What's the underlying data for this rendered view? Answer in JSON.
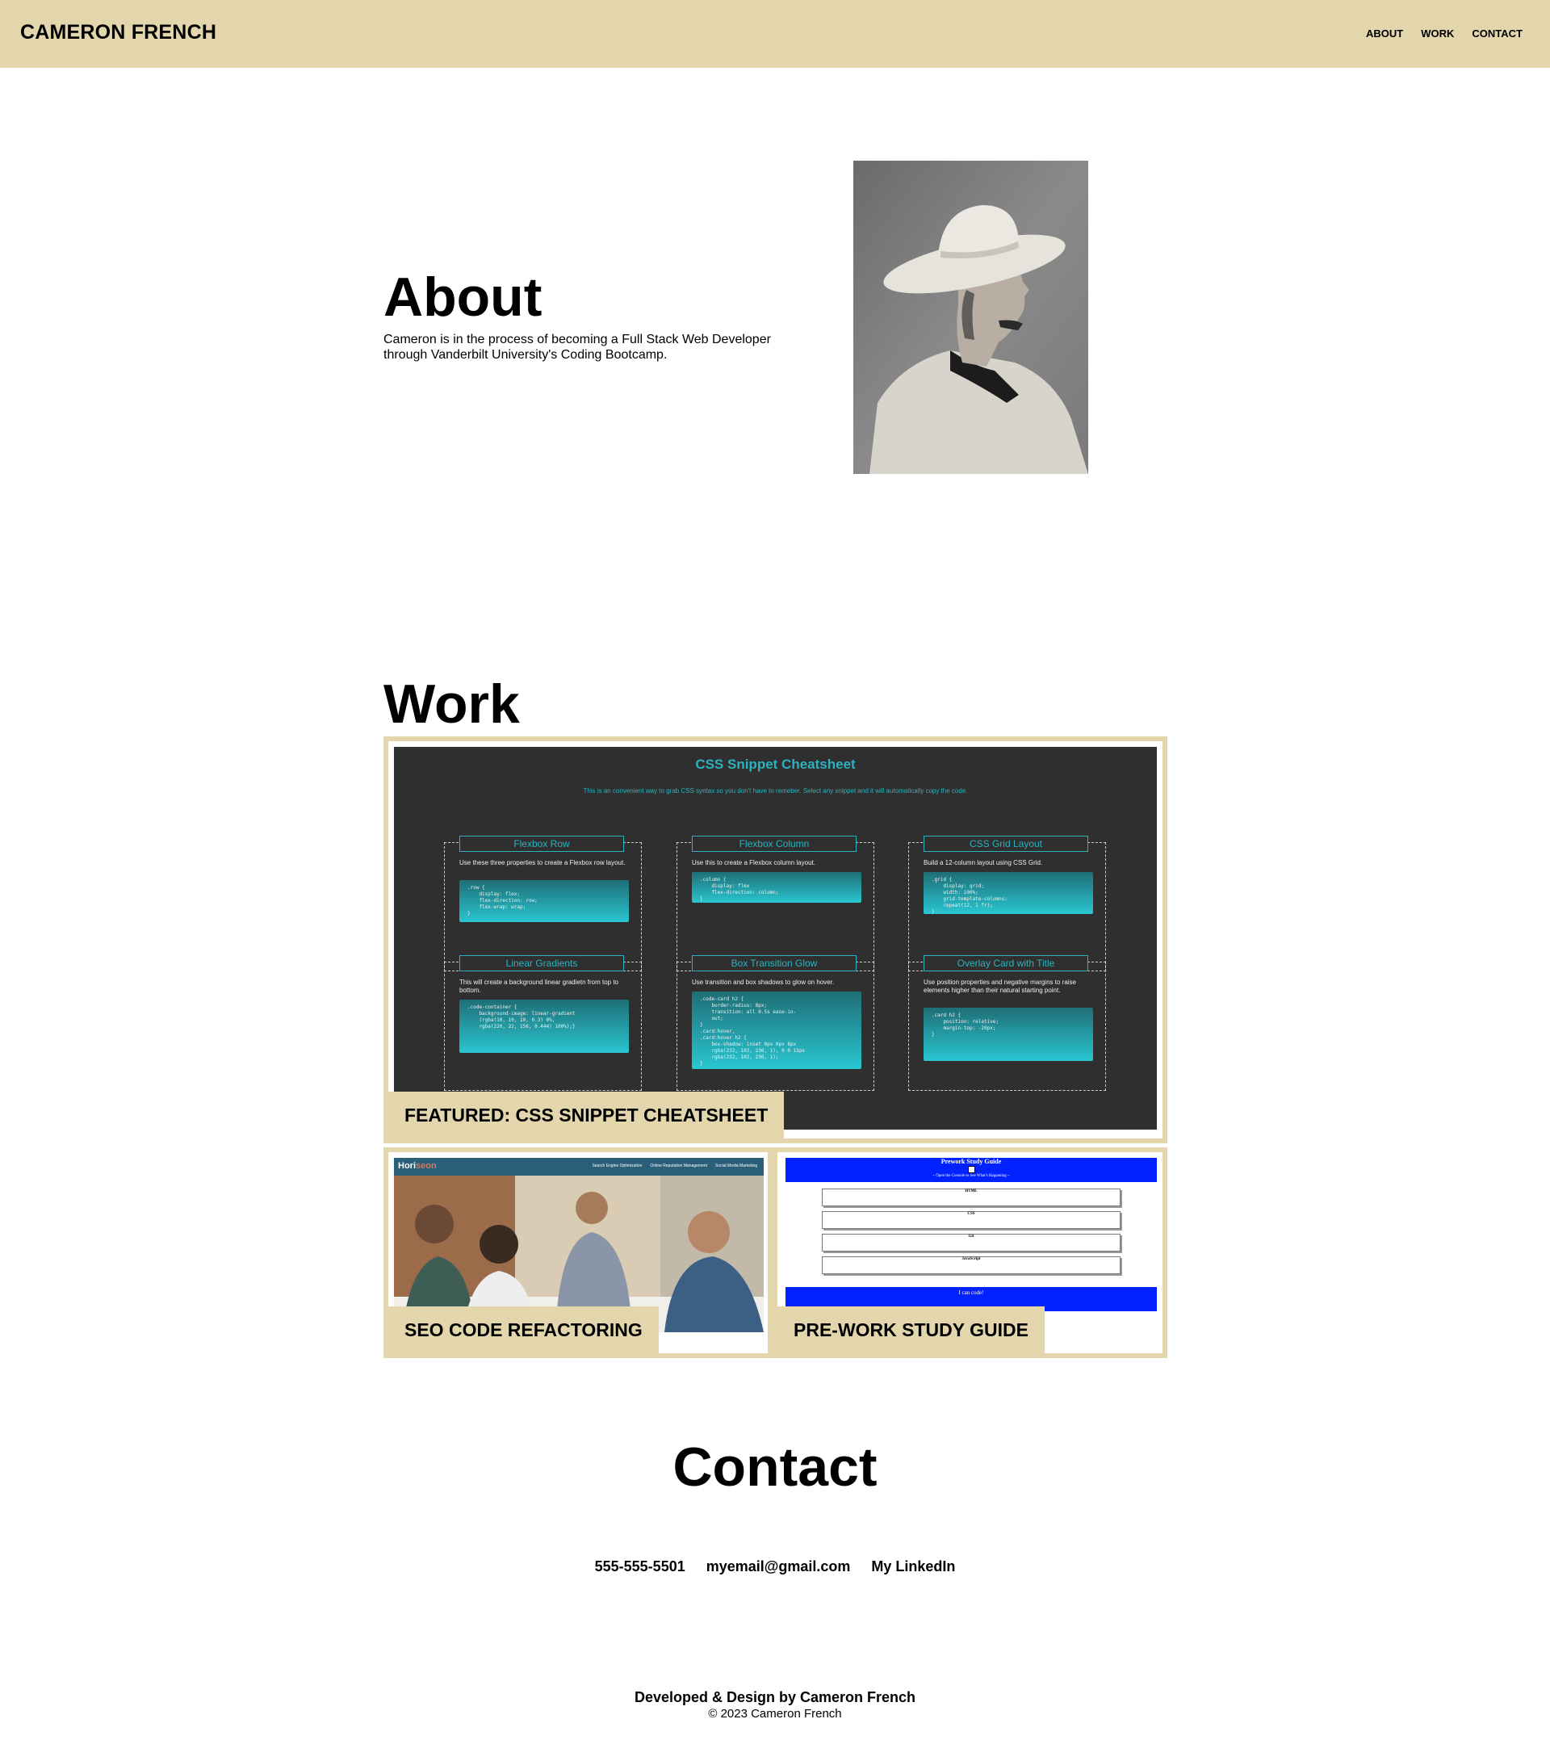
{
  "header": {
    "brand": "CAMERON FRENCH",
    "nav": {
      "about": "ABOUT",
      "work": "WORK",
      "contact": "CONTACT"
    }
  },
  "about": {
    "title": "About",
    "text": "Cameron is in the process of becoming a Full Stack Web Developer through Vanderbilt University's Coding Bootcamp."
  },
  "work": {
    "title": "Work",
    "featured_label": "FEATURED: CSS SNIPPET CHEATSHEET",
    "seo_label": "SEO CODE REFACTORING",
    "prework_label": "PRE-WORK STUDY GUIDE",
    "cheatsheet": {
      "title": "CSS Snippet Cheatsheet",
      "subtitle": "This is an convenient way to grab CSS syntax so you don't have to remeber. Select any snippet and it will automatically copy the code.",
      "snippets": [
        {
          "title": "Flexbox Row",
          "desc": "Use these three properties to create a Flexbox row layout.",
          "code": ".row {\n    display: flex;\n    flex-direction: row;\n    flex-wrap: wrap;\n}"
        },
        {
          "title": "Flexbox Column",
          "desc": "Use this to create a Flexbox column layout.",
          "code": ".column {\n    display: flex\n    flex-direction: column;\n}"
        },
        {
          "title": "CSS Grid Layout",
          "desc": "Build a 12-column layout using CSS Grid.",
          "code": ".grid {\n    display: grid;\n    width: 100%;\n    grid-template-columns:\n    repeat(12, 1 fr);\n}"
        },
        {
          "title": "Linear Gradients",
          "desc": "This will create a background linear gradietn from top to bottom.",
          "code": ".code-container {\n    background-image: linear-gradient\n    (rgba(10, 10, 10, 0.3) 0%,\n    rgba(220, 22, 156, 0.444) 100%);}"
        },
        {
          "title": "Box Transition Glow",
          "desc": "Use transition and box shadows to glow on hover.",
          "code": ".code-card h2 {\n    border-radius: 8px;\n    transition: all 0.5s ease-in-\n    out;\n}\n.card:hover,\n.card:hover h2 {\n    box-shadow: inset 0px 0px 8px\n    rgba(232, 102, 236, 1), 0 0 15px\n    rgba(232, 102, 236, 1);\n}"
        },
        {
          "title": "Overlay Card with Title",
          "desc": "Use position properties and negative margins to raise elements higher than their natural starting point.",
          "code": ".card h2 {\n    position: relative;\n    margin-top: -20px;\n}"
        }
      ]
    },
    "seo_shot": {
      "logo": "Hori",
      "logo_accent": "seon",
      "menu": [
        "Search Engine Optimization",
        "Online Reputation Management",
        "Social Media Marketing"
      ]
    },
    "prework_shot": {
      "title": "Prework Study Guide",
      "subtitle": "~ Open the Console to See What's Happening ~",
      "sections": [
        "HTML",
        "CSS",
        "Git",
        "JavaScript"
      ],
      "footer": "I can code!"
    }
  },
  "contact": {
    "title": "Contact",
    "phone": "555-555-5501",
    "email": "myemail@gmail.com",
    "linkedin": "My LinkedIn"
  },
  "footer": {
    "developed": "Developed & Design by Cameron French",
    "copyright": "© 2023 Cameron French"
  },
  "colors": {
    "accent": "#e3d6ad",
    "cheatsheet_bg": "#2f2f2f",
    "cheatsheet_teal": "#2ab3bf",
    "prework_blue": "#0022ff"
  }
}
